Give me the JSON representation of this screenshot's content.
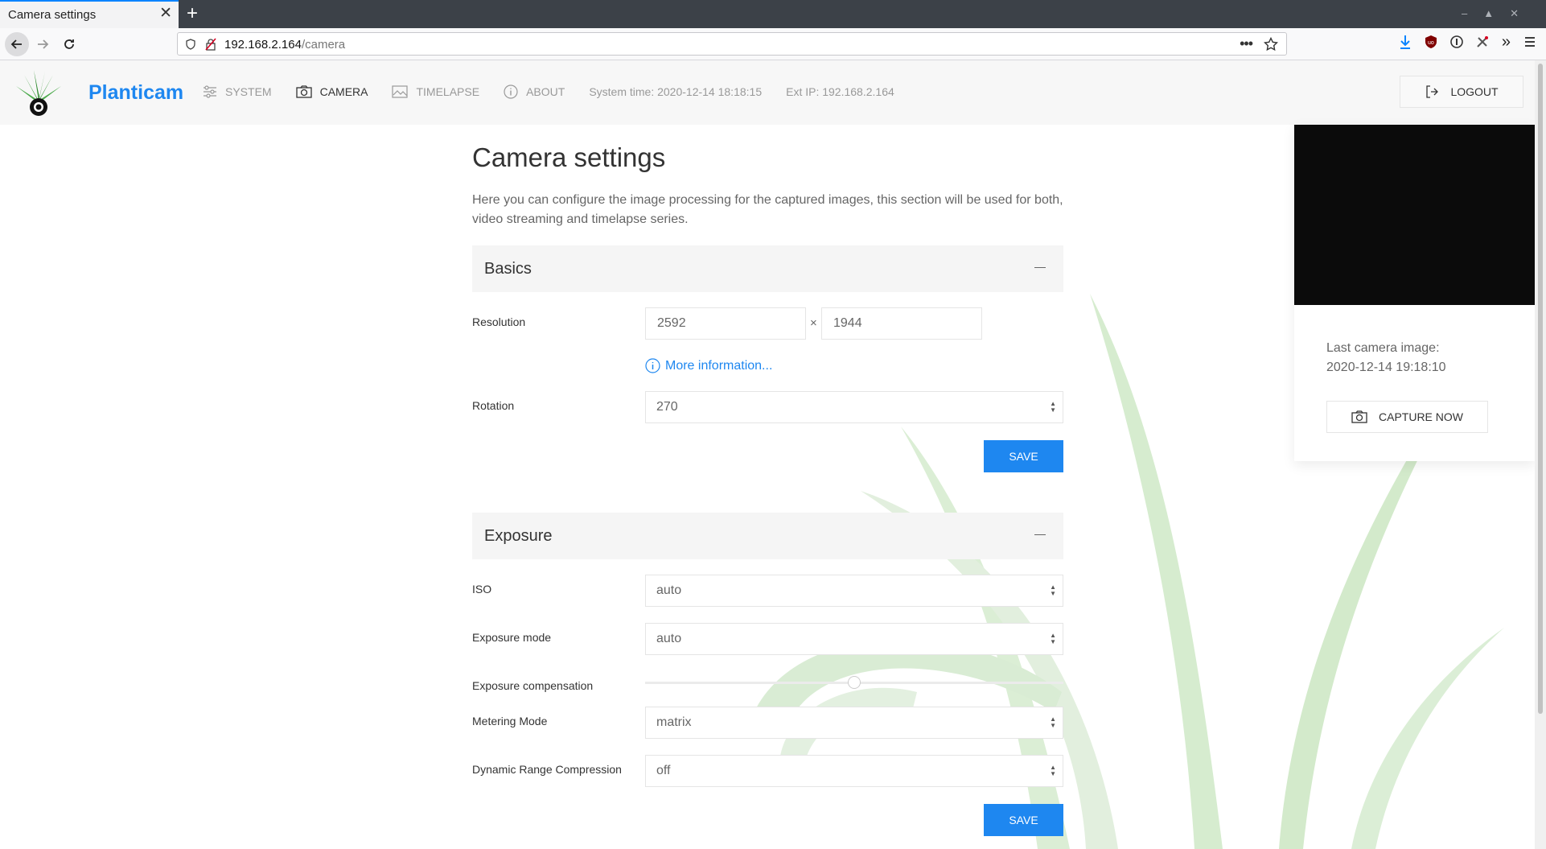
{
  "browser": {
    "tab_title": "Camera settings",
    "url_host": "192.168.2.164",
    "url_path": "/camera"
  },
  "header": {
    "brand": "Planticam",
    "menu": [
      {
        "label": "SYSTEM",
        "icon": "sliders-icon",
        "active": false
      },
      {
        "label": "CAMERA",
        "icon": "camera-icon",
        "active": true
      },
      {
        "label": "TIMELAPSE",
        "icon": "image-icon",
        "active": false
      },
      {
        "label": "ABOUT",
        "icon": "info-icon",
        "active": false
      }
    ],
    "system_time": "System time: 2020-12-14 18:18:15",
    "ext_ip": "Ext IP: 192.168.2.164",
    "logout_label": "LOGOUT"
  },
  "page": {
    "title": "Camera settings",
    "description": "Here you can configure the image processing for the captured images, this section will be used for both, video streaming and timelapse series."
  },
  "basics": {
    "title": "Basics",
    "resolution_label": "Resolution",
    "resolution_width": "2592",
    "resolution_height": "1944",
    "times": "×",
    "more_info": "More information...",
    "rotation_label": "Rotation",
    "rotation_value": "270",
    "save_label": "SAVE"
  },
  "exposure": {
    "title": "Exposure",
    "iso_label": "ISO",
    "iso_value": "auto",
    "mode_label": "Exposure mode",
    "mode_value": "auto",
    "compensation_label": "Exposure compensation",
    "compensation_position": 0.5,
    "metering_label": "Metering Mode",
    "metering_value": "matrix",
    "drc_label": "Dynamic Range Compression",
    "drc_value": "off",
    "save_label": "SAVE"
  },
  "camera_card": {
    "last_image_label": "Last camera image:",
    "last_image_time": "2020-12-14 19:18:10",
    "capture_label": "CAPTURE NOW"
  },
  "colors": {
    "accent": "#1e87f0",
    "leaf": "#d9ecd4"
  }
}
